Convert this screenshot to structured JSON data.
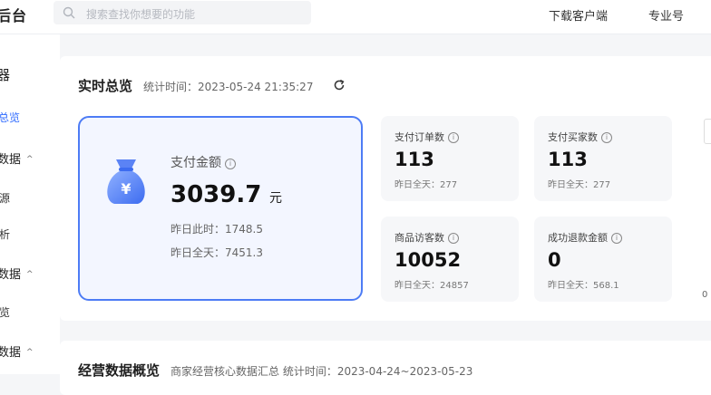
{
  "header": {
    "brand_text": "后台",
    "search_placeholder": "搜索查找你想要的功能",
    "links": [
      "下载客户端",
      "专业号"
    ]
  },
  "sidebar": {
    "items": [
      {
        "label": "器",
        "type": "group"
      },
      {
        "label": "总览",
        "type": "active"
      },
      {
        "label": "数据",
        "type": "group-caret"
      },
      {
        "label": "源",
        "type": "item"
      },
      {
        "label": "析",
        "type": "item"
      },
      {
        "label": "数据",
        "type": "group-caret"
      },
      {
        "label": "览",
        "type": "item"
      },
      {
        "label": "数据",
        "type": "group-caret"
      }
    ]
  },
  "realtime": {
    "title": "实时总览",
    "stat_time": "统计时间：2023-05-24 21:35:27",
    "main": {
      "label": "支付金额",
      "value": "3039.7",
      "unit": "元",
      "yesterday_now": "昨日此时：1748.5",
      "yesterday_all": "昨日全天：7451.3"
    },
    "metrics": [
      {
        "label": "支付订单数",
        "value": "113",
        "sub": "昨日全天：277"
      },
      {
        "label": "支付买家数",
        "value": "113",
        "sub": "昨日全天：277"
      },
      {
        "label": "商品访客数",
        "value": "10052",
        "sub": "昨日全天：24857"
      },
      {
        "label": "成功退款金额",
        "value": "0",
        "sub": "昨日全天：568.1"
      }
    ],
    "edge_fragment": "0"
  },
  "operations": {
    "title": "经营数据概览",
    "subtitle": "商家经营核心数据汇总  统计时间：2023-04-24~2023-05-23"
  },
  "colors": {
    "accent": "#2f6bff",
    "main_border": "#4d7cf5",
    "main_bg": "#f3f6ff"
  }
}
